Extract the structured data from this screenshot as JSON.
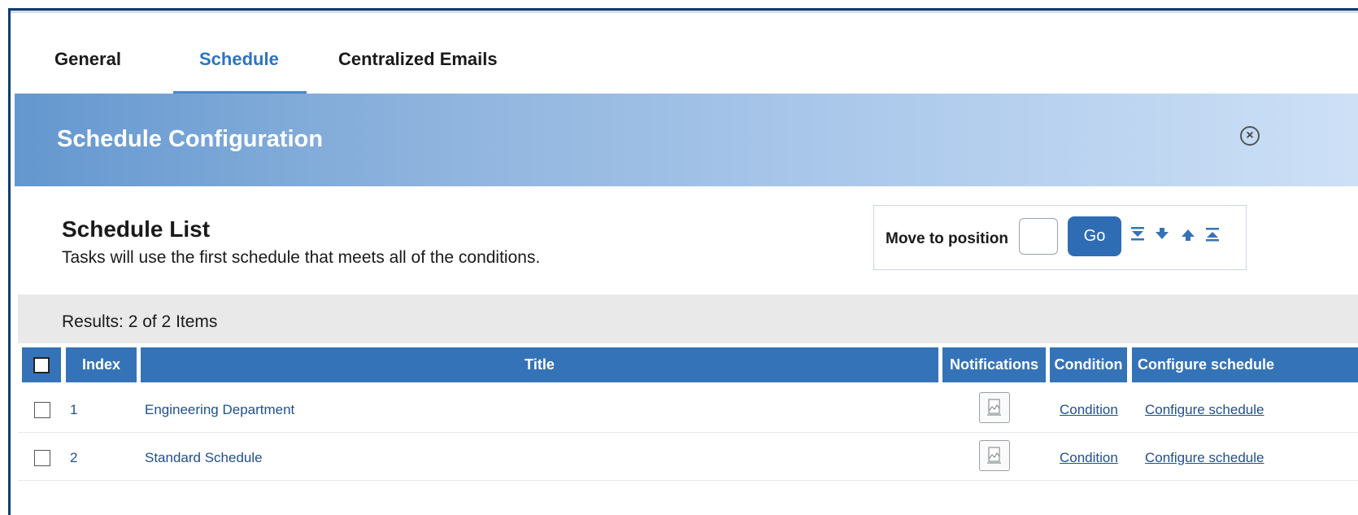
{
  "tabs": [
    {
      "label": "General"
    },
    {
      "label": "Schedule",
      "active": true
    },
    {
      "label": "Centralized Emails"
    }
  ],
  "banner": {
    "title": "Schedule Configuration",
    "close_icon": "close-circle-icon"
  },
  "schedule_list": {
    "title": "Schedule List",
    "subtitle": "Tasks will use the first schedule that meets all of the conditions."
  },
  "move": {
    "label": "Move to position",
    "input_value": "",
    "go_label": "Go",
    "icons": [
      "move-to-bottom-icon",
      "move-down-icon",
      "move-up-icon",
      "move-to-top-icon"
    ]
  },
  "results": {
    "text": "Results: 2 of 2 Items"
  },
  "table": {
    "columns": [
      "Index",
      "Title",
      "Notifications",
      "Condition",
      "Configure schedule"
    ],
    "rows": [
      {
        "index": "1",
        "title": "Engineering Department",
        "condition": "Condition",
        "configure": "Configure schedule"
      },
      {
        "index": "2",
        "title": "Standard Schedule",
        "condition": "Condition",
        "configure": "Configure schedule"
      }
    ]
  },
  "colors": {
    "accent": "#2e74c0",
    "header_bg": "#3573b8",
    "button_bg": "#2e6db4",
    "results_bg": "#e9e9e9"
  }
}
